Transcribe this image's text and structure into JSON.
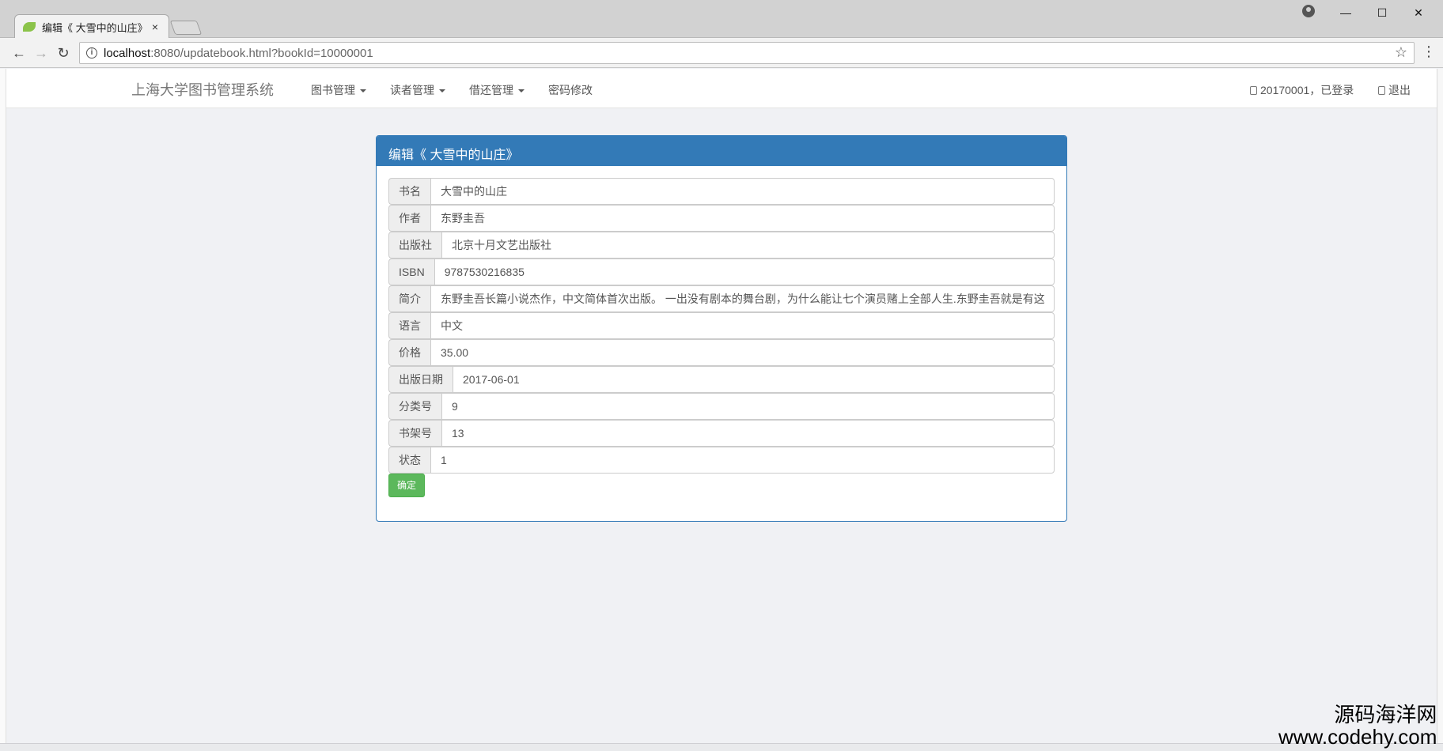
{
  "browser": {
    "tab_title": "编辑《 大雪中的山庄》",
    "tab_close": "×",
    "url_host": "localhost",
    "url_rest": ":8080/updatebook.html?bookId=10000001",
    "controls": {
      "minimize": "—",
      "maximize": "☐",
      "close": "✕"
    },
    "nav": {
      "back": "←",
      "forward": "→",
      "reload": "↻",
      "star": "☆",
      "menu": "⋮",
      "info": "i"
    }
  },
  "navbar": {
    "brand": "上海大学图书管理系统",
    "menus": [
      {
        "label": "图书管理"
      },
      {
        "label": "读者管理"
      },
      {
        "label": "借还管理"
      },
      {
        "label": "密码修改"
      }
    ],
    "user_status": "20170001，已登录",
    "logout": "退出"
  },
  "panel": {
    "title": "编辑《 大雪中的山庄》",
    "fields": [
      {
        "label": "书名",
        "value": "大雪中的山庄"
      },
      {
        "label": "作者",
        "value": "东野圭吾"
      },
      {
        "label": "出版社",
        "value": "北京十月文艺出版社"
      },
      {
        "label": "ISBN",
        "value": "9787530216835"
      },
      {
        "label": "简介",
        "value": "东野圭吾长篇小说杰作，中文简体首次出版。 一出没有剧本的舞台剧，为什么能让七个演员赌上全部人生.东野圭吾就是有这"
      },
      {
        "label": "语言",
        "value": "中文"
      },
      {
        "label": "价格",
        "value": "35.00"
      },
      {
        "label": "出版日期",
        "value": "2017-06-01"
      },
      {
        "label": "分类号",
        "value": "9"
      },
      {
        "label": "书架号",
        "value": "13"
      },
      {
        "label": "状态",
        "value": "1"
      }
    ],
    "submit": "确定"
  },
  "watermark": {
    "line1": "源码海洋网",
    "line2": "www.codehy.com"
  },
  "colors": {
    "primary": "#337ab7",
    "success": "#5cb85c",
    "page_bg": "#f0f1f4"
  }
}
